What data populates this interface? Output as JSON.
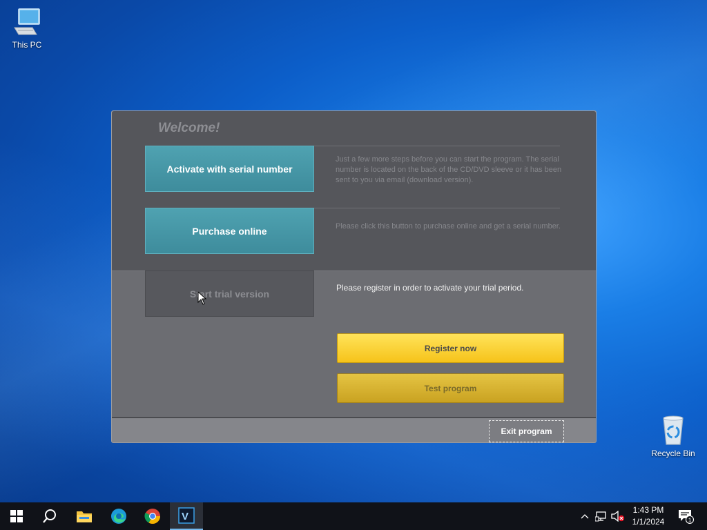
{
  "desktop": {
    "icons": [
      {
        "label": "This PC",
        "icon": "computer-icon"
      },
      {
        "label": "Recycle Bin",
        "icon": "recycle-bin-icon"
      }
    ]
  },
  "dialog": {
    "welcome": "Welcome!",
    "activate_label": "Activate with serial number",
    "activate_desc": "Just a few more steps before you can start the program. The serial number is located on the back of the CD/DVD sleeve or it has been sent to you via email (download version).",
    "purchase_label": "Purchase online",
    "purchase_desc": "Please click this button to purchase online and get a serial number.",
    "trial_label": "Start trial version",
    "trial_desc": "Please register in order to activate your trial period.",
    "register_label": "Register now",
    "test_label": "Test program",
    "exit_label": "Exit program",
    "colors": {
      "teal": "#4a9aab",
      "yellow": "#ffd633",
      "panel": "#55565b"
    }
  },
  "taskbar": {
    "apps": [
      {
        "name": "start-icon"
      },
      {
        "name": "search-icon"
      },
      {
        "name": "file-explorer-icon"
      },
      {
        "name": "edge-icon"
      },
      {
        "name": "chrome-icon"
      },
      {
        "name": "app-v-icon",
        "active": true
      }
    ],
    "app_letter": "V",
    "time": "1:43 PM",
    "date": "1/1/2024",
    "notification_count": "1"
  }
}
